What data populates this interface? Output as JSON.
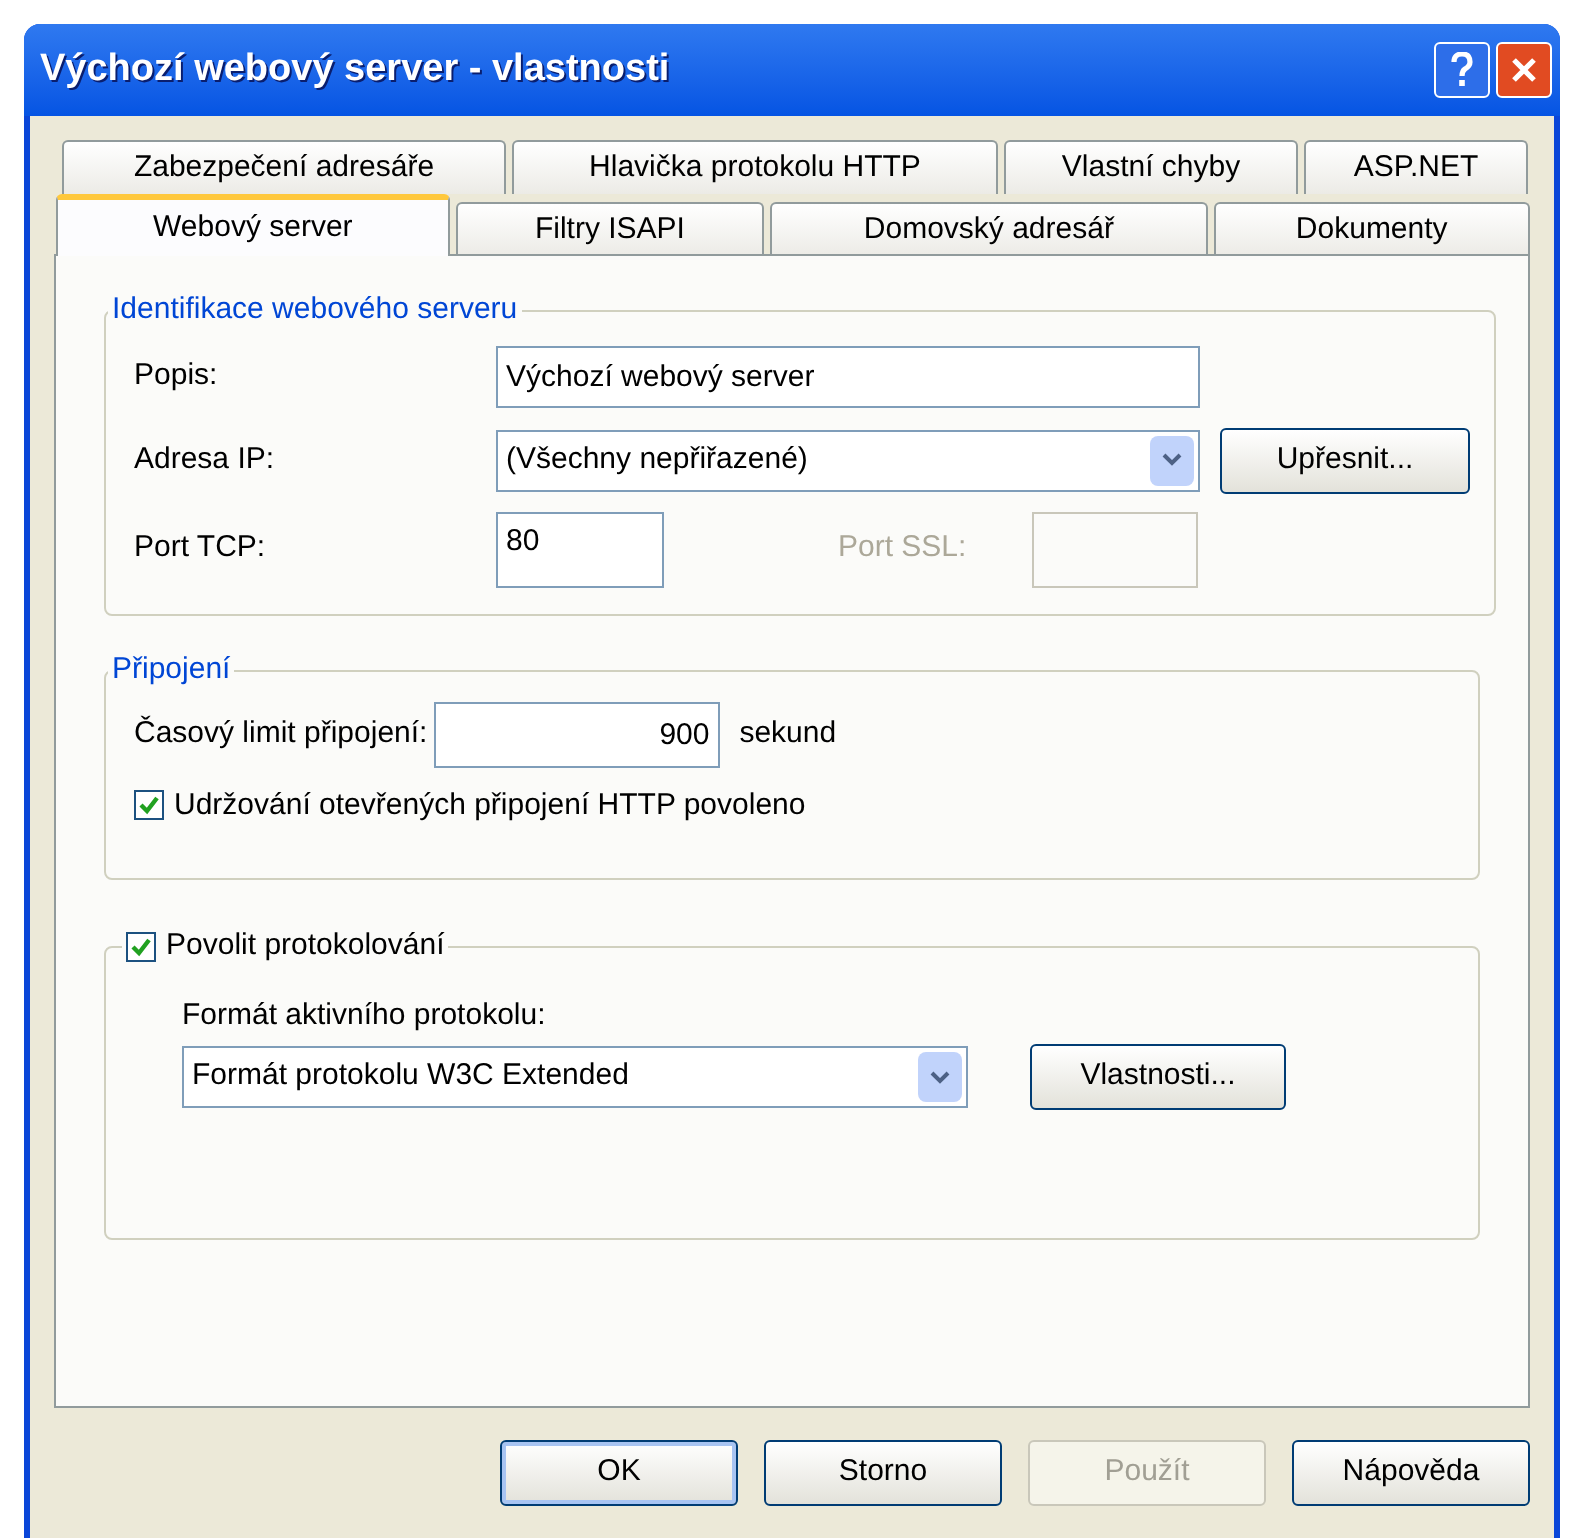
{
  "window": {
    "title": "Výchozí webový server - vlastnosti"
  },
  "tab_rows": [
    {
      "tabs": [
        {
          "label": "Zabezpečení adresáře",
          "selected": false
        },
        {
          "label": "Hlavička protokolu HTTP",
          "selected": false
        },
        {
          "label": "Vlastní chyby",
          "selected": false
        },
        {
          "label": "ASP.NET",
          "selected": false
        }
      ]
    },
    {
      "tabs": [
        {
          "label": "Webový server",
          "selected": true
        },
        {
          "label": "Filtry ISAPI",
          "selected": false
        },
        {
          "label": "Domovský adresář",
          "selected": false
        },
        {
          "label": "Dokumenty",
          "selected": false
        }
      ]
    }
  ],
  "identification": {
    "legend": "Identifikace webového serveru",
    "description": {
      "label": "Popis:",
      "value": "Výchozí webový server"
    },
    "ip_address": {
      "label": "Adresa IP:",
      "value": "(Všechny nepřiřazené)",
      "button": "Upřesnit..."
    },
    "tcp_port": {
      "label": "Port TCP:",
      "value": "80"
    },
    "ssl_port": {
      "label": "Port SSL:",
      "disabled": true
    }
  },
  "connections": {
    "legend": "Připojení",
    "timeout": {
      "label": "Časový limit připojení:",
      "value": "900",
      "unit": "sekund"
    },
    "keep_alive": {
      "label": "Udržování otevřených připojení HTTP povoleno",
      "checked": true
    }
  },
  "logging": {
    "enable": {
      "label": "Povolit protokolování",
      "checked": true
    },
    "format_label": "Formát aktivního protokolu:",
    "format_value": "Formát protokolu W3C Extended",
    "properties_button": "Vlastnosti..."
  },
  "buttons": [
    {
      "label": "OK",
      "disabled": false,
      "default": true
    },
    {
      "label": "Storno",
      "disabled": false,
      "default": false
    },
    {
      "label": "Použít",
      "disabled": true,
      "default": false
    },
    {
      "label": "Nápověda",
      "disabled": false,
      "default": false
    }
  ]
}
